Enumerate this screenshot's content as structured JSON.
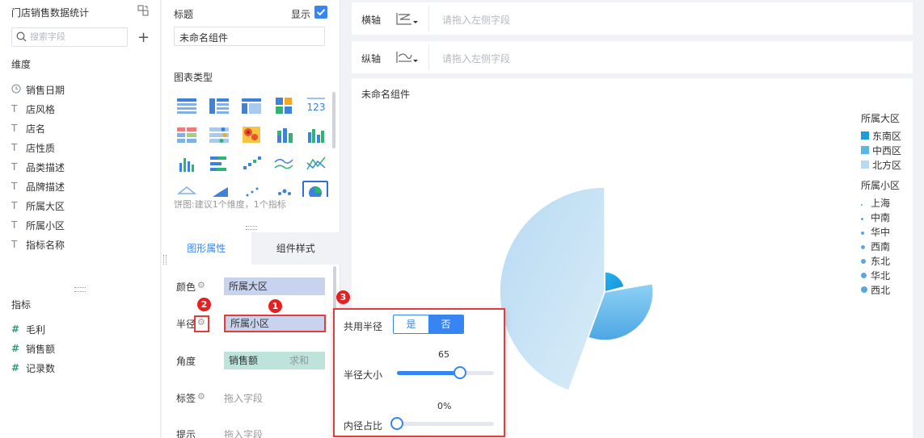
{
  "left": {
    "dataset_name": "门店销售数据统计",
    "search_placeholder": "搜索字段",
    "dimensions_title": "维度",
    "dimensions": [
      {
        "name": "销售日期",
        "icon": "clock-icon"
      },
      {
        "name": "店风格",
        "icon": "text-type-icon"
      },
      {
        "name": "店名",
        "icon": "text-type-icon"
      },
      {
        "name": "店性质",
        "icon": "text-type-icon"
      },
      {
        "name": "品类描述",
        "icon": "text-type-icon"
      },
      {
        "name": "品牌描述",
        "icon": "text-type-icon"
      },
      {
        "name": "所属大区",
        "icon": "text-type-icon"
      },
      {
        "name": "所属小区",
        "icon": "text-type-icon"
      },
      {
        "name": "指标名称",
        "icon": "text-type-icon"
      }
    ],
    "measures_title": "指标",
    "measures": [
      {
        "name": "毛利",
        "icon": "hash-icon"
      },
      {
        "name": "销售额",
        "icon": "hash-icon"
      },
      {
        "name": "记录数",
        "icon": "hash-icon"
      }
    ]
  },
  "middle": {
    "title_label": "标题",
    "show_label": "显示",
    "show_checked": true,
    "title_value": "未命名组件",
    "chart_type_label": "图表类型",
    "chart_hint": "饼图:建议1个维度，1个指标",
    "tab_graph": "图形属性",
    "tab_style": "组件样式",
    "props": {
      "color_label": "颜色",
      "color_value": "所属大区",
      "radius_label": "半径",
      "radius_value": "所属小区",
      "angle_label": "角度",
      "angle_value": "销售额",
      "angle_agg": "求和",
      "tag_label": "标签",
      "tag_placeholder": "拖入字段",
      "tip_label": "提示",
      "tip_placeholder": "拖入字段"
    }
  },
  "right": {
    "x_axis_label": "横轴",
    "y_axis_label": "纵轴",
    "drop_placeholder": "请拖入左侧字段",
    "chart_title": "未命名组件",
    "legend_region_title": "所属大区",
    "legend_regions": [
      {
        "name": "东南区",
        "color": "#1b9ed9"
      },
      {
        "name": "中西区",
        "color": "#5bb6e8"
      },
      {
        "name": "北方区",
        "color": "#b4d9f1"
      }
    ],
    "legend_sub_title": "所属小区",
    "legend_subs": [
      "上海",
      "中南",
      "华中",
      "西南",
      "东北",
      "华北",
      "西北"
    ]
  },
  "popup": {
    "share_radius_label": "共用半径",
    "yes_label": "是",
    "no_label": "否",
    "selected": "否",
    "radius_size_label": "半径大小",
    "radius_size_value": "65",
    "radius_size": 65,
    "inner_ratio_label": "内径占比",
    "inner_ratio_value": "0%",
    "inner_ratio": 0
  },
  "badges": [
    "1",
    "2",
    "3"
  ],
  "chart_data": {
    "type": "pie",
    "title": "未命名组件",
    "categories": [
      "东南区",
      "中西区",
      "北方区"
    ],
    "series": [
      {
        "name": "东南区",
        "values": [
          25
        ]
      },
      {
        "name": "中西区",
        "values": [
          60
        ]
      },
      {
        "name": "北方区",
        "values": [
          130
        ]
      }
    ]
  }
}
